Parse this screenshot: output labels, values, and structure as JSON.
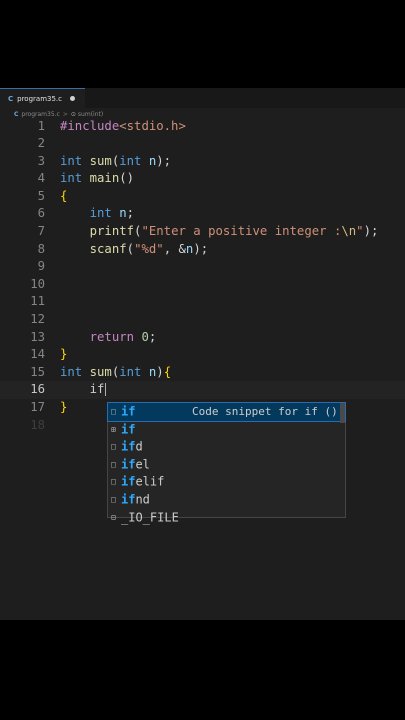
{
  "tab": {
    "label": "program35.c",
    "icon": "C"
  },
  "breadcrumb": {
    "file": "program35.c",
    "separator": ">",
    "symbol": "sum(int)"
  },
  "code_lines": [
    {
      "num": "1",
      "tokens": [
        [
          "#include",
          "pre"
        ],
        [
          "<stdio.h>",
          "inc"
        ]
      ]
    },
    {
      "num": "2",
      "tokens": []
    },
    {
      "num": "3",
      "tokens": [
        [
          "int",
          "kw"
        ],
        [
          " ",
          "pun"
        ],
        [
          "sum",
          "fn"
        ],
        [
          "(",
          "pun"
        ],
        [
          "int",
          "kw"
        ],
        [
          " ",
          "pun"
        ],
        [
          "n",
          "id"
        ],
        [
          ");",
          "pun"
        ]
      ]
    },
    {
      "num": "4",
      "tokens": [
        [
          "int",
          "kw"
        ],
        [
          " ",
          "pun"
        ],
        [
          "main",
          "fn"
        ],
        [
          "()",
          "pun"
        ]
      ]
    },
    {
      "num": "5",
      "tokens": [
        [
          "{",
          "brace"
        ]
      ]
    },
    {
      "num": "6",
      "tokens": [
        [
          "    ",
          "pun"
        ],
        [
          "int",
          "kw"
        ],
        [
          " ",
          "pun"
        ],
        [
          "n",
          "id"
        ],
        [
          ";",
          "pun"
        ]
      ]
    },
    {
      "num": "7",
      "tokens": [
        [
          "    ",
          "pun"
        ],
        [
          "printf",
          "fn"
        ],
        [
          "(",
          "pun"
        ],
        [
          "\"Enter a positive integer :",
          "str"
        ],
        [
          "\\n",
          "esc"
        ],
        [
          "\"",
          "str"
        ],
        [
          ");",
          "pun"
        ]
      ]
    },
    {
      "num": "8",
      "tokens": [
        [
          "    ",
          "pun"
        ],
        [
          "scanf",
          "fn"
        ],
        [
          "(",
          "pun"
        ],
        [
          "\"%d\"",
          "str"
        ],
        [
          ", &",
          "pun"
        ],
        [
          "n",
          "id"
        ],
        [
          ");",
          "pun"
        ]
      ]
    },
    {
      "num": "9",
      "tokens": []
    },
    {
      "num": "10",
      "tokens": []
    },
    {
      "num": "11",
      "tokens": []
    },
    {
      "num": "12",
      "tokens": []
    },
    {
      "num": "13",
      "tokens": [
        [
          "    ",
          "pun"
        ],
        [
          "return",
          "ctl"
        ],
        [
          " ",
          "pun"
        ],
        [
          "0",
          "num"
        ],
        [
          ";",
          "pun"
        ]
      ]
    },
    {
      "num": "14",
      "tokens": [
        [
          "}",
          "brace"
        ]
      ]
    },
    {
      "num": "15",
      "tokens": [
        [
          "int",
          "kw"
        ],
        [
          " ",
          "pun"
        ],
        [
          "sum",
          "fn"
        ],
        [
          "(",
          "pun"
        ],
        [
          "int",
          "kw"
        ],
        [
          " ",
          "pun"
        ],
        [
          "n",
          "id"
        ],
        [
          ")",
          "pun"
        ],
        [
          "{",
          "brace"
        ]
      ]
    },
    {
      "num": "16",
      "tokens": [
        [
          "    ",
          "pun"
        ],
        [
          "if",
          "plain"
        ]
      ],
      "current": true
    },
    {
      "num": "17",
      "tokens": [
        [
          "}",
          "brace"
        ]
      ]
    },
    {
      "num": "18",
      "tokens": [],
      "dim": true
    }
  ],
  "suggestions": [
    {
      "icon": "snippet",
      "match": "if",
      "rest": "",
      "detail": "Code snippet for if ()",
      "selected": true
    },
    {
      "icon": "keyword",
      "match": "if",
      "rest": "",
      "detail": ""
    },
    {
      "icon": "snippet",
      "match": "if",
      "rest": "d",
      "detail": ""
    },
    {
      "icon": "snippet",
      "match": "if",
      "rest": "el",
      "detail": ""
    },
    {
      "icon": "snippet",
      "match": "if",
      "rest": "elif",
      "detail": ""
    },
    {
      "icon": "snippet",
      "match": "if",
      "rest": "nd",
      "detail": ""
    },
    {
      "icon": "struct",
      "match": "",
      "rest": "_IO_FILE",
      "detail": ""
    }
  ],
  "icons": {
    "snippet": "□",
    "keyword": "⊞",
    "struct": "⊟"
  },
  "colors": {
    "editor_bg": "#1e1e1e",
    "suggest_selected": "#04395e",
    "match_highlight": "#2aaaff"
  }
}
